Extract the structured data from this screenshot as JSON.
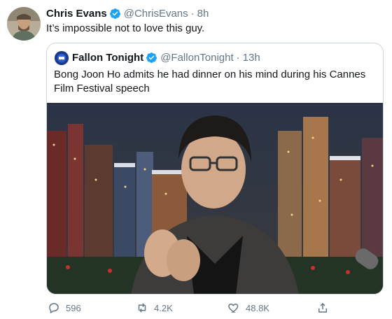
{
  "tweet": {
    "author_name": "Chris Evans",
    "author_handle": "@ChrisEvans",
    "separator": "·",
    "time": "8h",
    "text": "It’s impossible not to love this guy."
  },
  "quoted": {
    "author_name": "Fallon Tonight",
    "author_handle": "@FallonTonight",
    "separator": "·",
    "time": "13h",
    "text": "Bong Joon Ho admits he had dinner on his mind during his Cannes Film Festival speech"
  },
  "actions": {
    "replies": "596",
    "retweets": "4.2K",
    "likes": "48.8K"
  },
  "colors": {
    "verified": "#1da1f2",
    "muted": "#657786",
    "border": "#ccd6dd"
  },
  "icons": {
    "verified": "verified-badge-icon",
    "reply": "reply-icon",
    "retweet": "retweet-icon",
    "like": "heart-icon",
    "share": "share-icon"
  }
}
